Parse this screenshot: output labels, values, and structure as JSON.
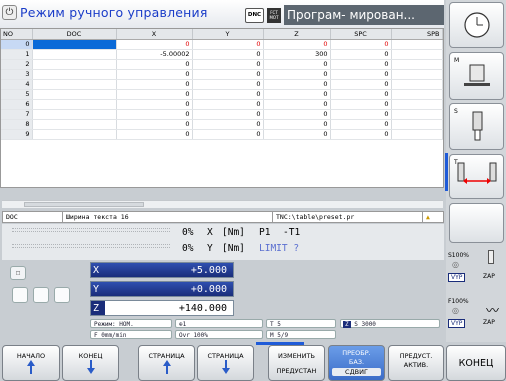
{
  "header": {
    "mode_title": "Режим ручного управления",
    "dnc_label": "DNC",
    "fct_label": "FCT MOT",
    "program_mode_title": "Програм- мирован..."
  },
  "table": {
    "columns": [
      "NO",
      "DOC",
      "X",
      "Y",
      "Z",
      "SPC",
      "SPB"
    ],
    "rows": [
      {
        "no": "0",
        "doc": "",
        "x": "0",
        "y": "0",
        "z": "0",
        "spc": "0",
        "x_red": true,
        "y_red": true,
        "z_red": true,
        "spc_red": true
      },
      {
        "no": "1",
        "doc": "",
        "x": "-5.00002",
        "y": "0",
        "z": "300",
        "spc": "0",
        "x_red": false,
        "y_red": false,
        "z_red": false,
        "spc_red": false
      },
      {
        "no": "2",
        "doc": "",
        "x": "0",
        "y": "0",
        "z": "0",
        "spc": "0"
      },
      {
        "no": "3",
        "doc": "",
        "x": "0",
        "y": "0",
        "z": "0",
        "spc": "0"
      },
      {
        "no": "4",
        "doc": "",
        "x": "0",
        "y": "0",
        "z": "0",
        "spc": "0"
      },
      {
        "no": "5",
        "doc": "",
        "x": "0",
        "y": "0",
        "z": "0",
        "spc": "0"
      },
      {
        "no": "6",
        "doc": "",
        "x": "0",
        "y": "0",
        "z": "0",
        "spc": "0"
      },
      {
        "no": "7",
        "doc": "",
        "x": "0",
        "y": "0",
        "z": "0",
        "spc": "0"
      },
      {
        "no": "8",
        "doc": "",
        "x": "0",
        "y": "0",
        "z": "0",
        "spc": "0"
      },
      {
        "no": "9",
        "doc": "",
        "x": "0",
        "y": "0",
        "z": "0",
        "spc": "0"
      }
    ]
  },
  "status": {
    "field": "DOC",
    "hint": "Ширина текста 16",
    "path": "TNC:\\table\\preset.pr"
  },
  "position": {
    "row1": {
      "pct": "0%",
      "axis": "X",
      "unit": "[Nm]",
      "p": "P1",
      "tool": "-T1"
    },
    "row2": {
      "pct": "0%",
      "axis": "Y",
      "unit": "[Nm]",
      "limit": "LIMIT ?"
    }
  },
  "axes": [
    {
      "label": "X",
      "value": "+5.000"
    },
    {
      "label": "Y",
      "value": "+0.000"
    },
    {
      "label": "Z",
      "value": "+140.000"
    }
  ],
  "info": {
    "mode": "Режим: НОМ.",
    "tool_num": "1",
    "t": "T 5",
    "s": "S 3000",
    "feed": "F 0mm/min",
    "ovr": "Ovr 100%",
    "m": "M 5/9",
    "z_label": "Z"
  },
  "right_panel": {
    "m_key": "M",
    "s_key": "S",
    "t_key": "T",
    "s_override": "S100%",
    "s_state": "VYP",
    "s_action": "ZAP",
    "f_override": "F100%",
    "f_state": "VYP",
    "f_action": "ZAP"
  },
  "softkeys": [
    {
      "label": "НАЧАЛО",
      "label2": ""
    },
    {
      "label": "КОНЕЦ",
      "label2": ""
    },
    {
      "label": "СТРАНИЦА",
      "label2": ""
    },
    {
      "label": "СТРАНИЦА",
      "label2": ""
    },
    {
      "label": "ИЗМЕНИТЬ",
      "label2": "ПРЕДУСТАН"
    },
    {
      "label": "ПРЕОБР.",
      "label2": "БАЗ."
    },
    {
      "label": "ПРЕДУСТ.",
      "label2": "АКТИВ."
    }
  ],
  "softkey_extra": "СДВИГ",
  "end_button": "КОНЕЦ",
  "colors": {
    "accent": "#1f5bd8",
    "cursor": "#0a6ad8",
    "axis_bg": "#1a2d7a",
    "error": "#e00000"
  }
}
